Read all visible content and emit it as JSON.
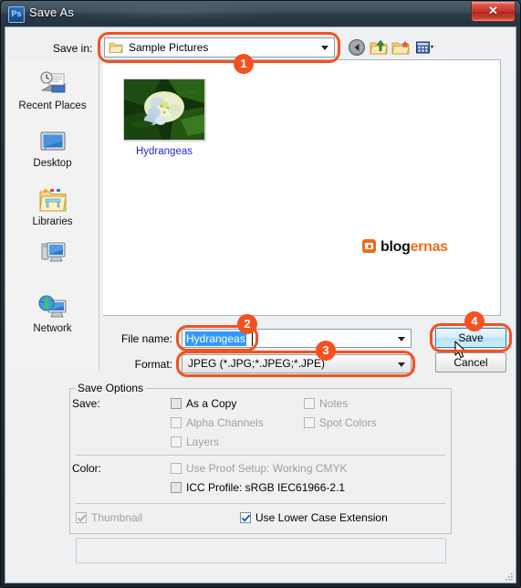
{
  "window": {
    "title": "Save As",
    "app_icon": "photoshop-ps-icon",
    "close_label": "✕"
  },
  "toolbar": {
    "save_in_label": "Save in:",
    "save_in_value": "Sample Pictures",
    "folder_icon": "folder-icon",
    "buttons": [
      {
        "name": "back-button",
        "icon": "back-arrow-icon"
      },
      {
        "name": "up-one-level-button",
        "icon": "up-folder-icon"
      },
      {
        "name": "create-new-folder-button",
        "icon": "new-folder-icon"
      },
      {
        "name": "views-button",
        "icon": "views-grid-icon"
      }
    ]
  },
  "places": [
    {
      "label": "Recent Places",
      "icon": "recent-places-icon"
    },
    {
      "label": "Desktop",
      "icon": "desktop-monitor-icon"
    },
    {
      "label": "Libraries",
      "icon": "libraries-folder-icon"
    },
    {
      "label": "",
      "icon": "computer-icon"
    },
    {
      "label": "Network",
      "icon": "network-globe-icon"
    }
  ],
  "file_list": {
    "items": [
      {
        "label": "Hydrangeas",
        "thumbnail": "hydrangeas-photo-thumbnail"
      }
    ],
    "watermark": {
      "icon": "blogernas-logo-icon",
      "text_dark": "blog",
      "text_accent": "ernas"
    }
  },
  "form": {
    "file_name_label": "File name:",
    "file_name_value": "Hydrangeas",
    "format_label": "Format:",
    "format_value": "JPEG (*.JPG;*.JPEG;*.JPE)"
  },
  "buttons": {
    "save": "Save",
    "cancel": "Cancel"
  },
  "save_options": {
    "group_title": "Save Options",
    "save_section_label": "Save:",
    "color_section_label": "Color:",
    "checkboxes": [
      {
        "label": "As a Copy",
        "checked": false,
        "disabled": false
      },
      {
        "label": "Notes",
        "checked": false,
        "disabled": true
      },
      {
        "label": "Alpha Channels",
        "checked": false,
        "disabled": true
      },
      {
        "label": "Spot Colors",
        "checked": false,
        "disabled": true
      },
      {
        "label": "Layers",
        "checked": false,
        "disabled": true
      },
      {
        "label": "Use Proof Setup:  Working CMYK",
        "checked": false,
        "disabled": true
      },
      {
        "label": "ICC Profile:  sRGB IEC61966-2.1",
        "checked": false,
        "disabled": false
      },
      {
        "label": "Thumbnail",
        "checked": true,
        "disabled": true
      },
      {
        "label": "Use Lower Case Extension",
        "checked": true,
        "disabled": false
      }
    ]
  },
  "annotations": {
    "badges": [
      {
        "number": "1"
      },
      {
        "number": "2"
      },
      {
        "number": "3"
      },
      {
        "number": "4"
      }
    ],
    "accent_color": "#f4511e"
  }
}
